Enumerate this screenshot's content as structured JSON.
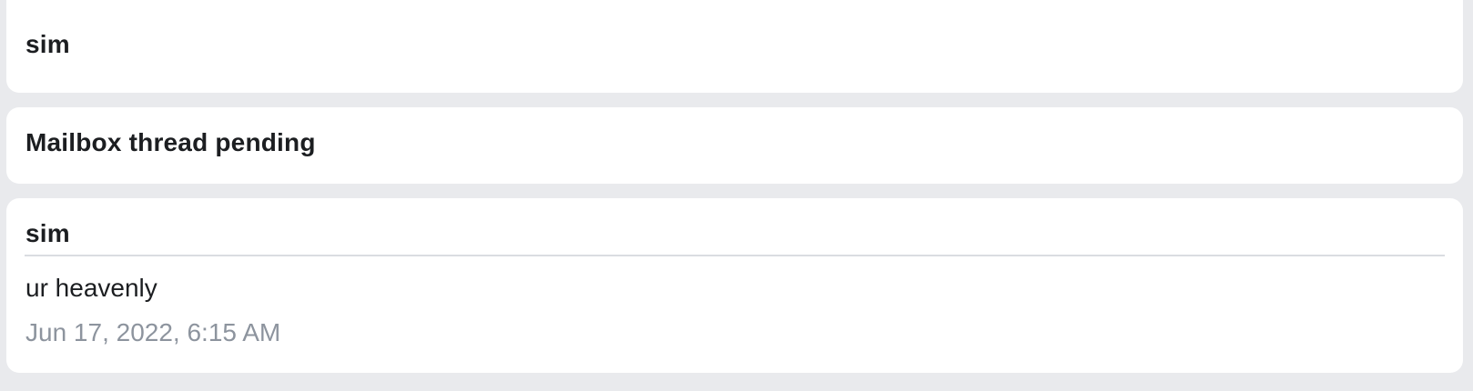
{
  "items": [
    {
      "sender": "sim"
    },
    {
      "title": "Mailbox thread pending"
    },
    {
      "sender": "sim",
      "body": "ur heavenly",
      "timestamp": "Jun 17, 2022, 6:15 AM"
    }
  ],
  "colors": {
    "background": "#e9eaed",
    "card": "#ffffff",
    "text": "#1c1e21",
    "muted_text": "#8d949e",
    "divider": "#dadde1"
  }
}
